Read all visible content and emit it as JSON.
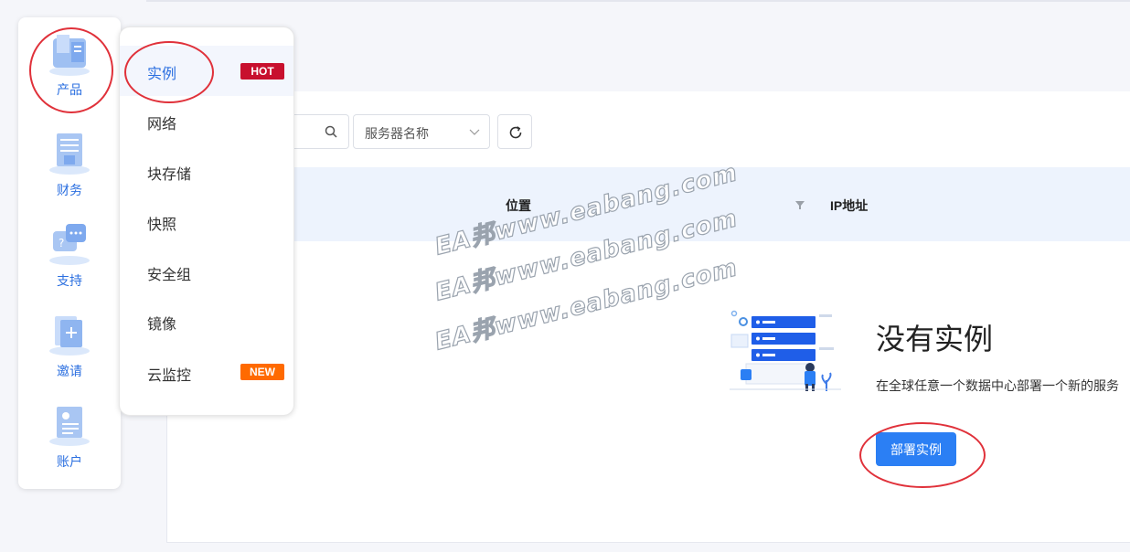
{
  "sidebar": {
    "items": [
      {
        "label": "产品",
        "icon": "product-icon"
      },
      {
        "label": "财务",
        "icon": "finance-icon"
      },
      {
        "label": "支持",
        "icon": "support-icon"
      },
      {
        "label": "邀请",
        "icon": "invite-icon"
      },
      {
        "label": "账户",
        "icon": "account-icon"
      }
    ]
  },
  "submenu": {
    "items": [
      {
        "label": "实例",
        "badge": "HOT",
        "badge_color": "#c8102e"
      },
      {
        "label": "网络"
      },
      {
        "label": "块存储"
      },
      {
        "label": "快照"
      },
      {
        "label": "安全组"
      },
      {
        "label": "镜像"
      },
      {
        "label": "云监控",
        "badge": "NEW",
        "badge_color": "#ff6a00"
      }
    ]
  },
  "toolbar": {
    "select_value": "服务器名称"
  },
  "table": {
    "columns": [
      "位置",
      "IP地址"
    ]
  },
  "empty_state": {
    "title": "没有实例",
    "description": "在全球任意一个数据中心部署一个新的服务",
    "button_label": "部署实例"
  },
  "watermark": {
    "text": "EA邦www.eabang.com"
  },
  "colors": {
    "accent": "#2b7ff4",
    "nav_label": "#2b6fe0",
    "highlight": "#e0313a",
    "table_header_bg": "#edf3fd"
  }
}
